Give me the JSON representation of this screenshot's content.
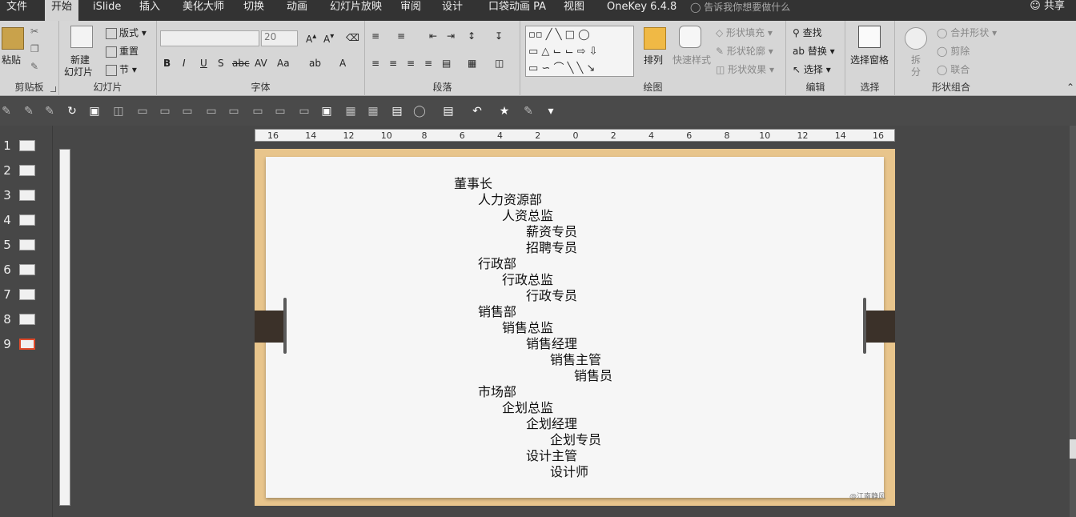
{
  "menu": {
    "tabs": [
      "文件",
      "开始",
      "iSlide",
      "插入",
      "美化大师",
      "切换",
      "动画",
      "幻灯片放映",
      "审阅",
      "设计",
      "口袋动画 PA",
      "视图",
      "OneKey 6.4.8"
    ],
    "active_index": 1,
    "tell_me": "告诉我你想要做什么",
    "share": "共享"
  },
  "ribbon": {
    "clipboard": {
      "paste": "粘贴",
      "label": "剪贴板"
    },
    "slides": {
      "new_slide": "新建",
      "new_slide2": "幻灯片",
      "layout": "版式",
      "reset": "重置",
      "section": "节",
      "label": "幻灯片"
    },
    "font": {
      "size": "20",
      "label": "字体"
    },
    "paragraph": {
      "label": "段落"
    },
    "drawing": {
      "arrange": "排列",
      "quick_styles": "快速样式",
      "shape_fill": "形状填充",
      "shape_outline": "形状轮廓",
      "shape_effects": "形状效果",
      "label": "绘图"
    },
    "editing": {
      "find": "查找",
      "replace": "替换",
      "select": "选择",
      "label": "编辑"
    },
    "selection": {
      "pane": "选择窗格",
      "label": "选择"
    },
    "shape_combine": {
      "split": "拆",
      "split2": "分",
      "merge": "合并形状",
      "cut": "剪除",
      "union": "联合",
      "label": "形状组合"
    }
  },
  "thumbnails": [
    "1",
    "2",
    "3",
    "4",
    "5",
    "6",
    "7",
    "8",
    "9"
  ],
  "selected_slide": 9,
  "ruler": [
    "16",
    "14",
    "12",
    "10",
    "8",
    "6",
    "4",
    "2",
    "0",
    "2",
    "4",
    "6",
    "8",
    "10",
    "12",
    "14",
    "16"
  ],
  "slide": {
    "org_chart": [
      {
        "text": "董事长",
        "level": 0
      },
      {
        "text": "人力资源部",
        "level": 1
      },
      {
        "text": "人资总监",
        "level": 2
      },
      {
        "text": "薪资专员",
        "level": 3
      },
      {
        "text": "招聘专员",
        "level": 3
      },
      {
        "text": "行政部",
        "level": 1
      },
      {
        "text": "行政总监",
        "level": 2
      },
      {
        "text": "行政专员",
        "level": 3
      },
      {
        "text": "销售部",
        "level": 1
      },
      {
        "text": "销售总监",
        "level": 2
      },
      {
        "text": "销售经理",
        "level": 3
      },
      {
        "text": "销售主管",
        "level": 4
      },
      {
        "text": "销售员",
        "level": 5
      },
      {
        "text": "市场部",
        "level": 1
      },
      {
        "text": "企划总监",
        "level": 2
      },
      {
        "text": "企划经理",
        "level": 3
      },
      {
        "text": "企划专员",
        "level": 4
      },
      {
        "text": "设计主管",
        "level": 3
      },
      {
        "text": "设计师",
        "level": 4
      }
    ],
    "watermark": "@江南静风"
  }
}
